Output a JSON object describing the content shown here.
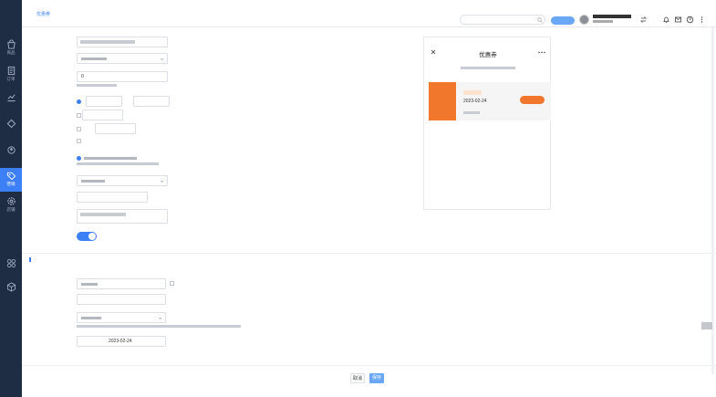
{
  "sidebar": {
    "logo": "",
    "items": [
      {
        "label": "商品",
        "icon": "bag-icon"
      },
      {
        "label": "订单",
        "icon": "document-icon"
      },
      {
        "label": "",
        "icon": "chart-icon"
      },
      {
        "label": "",
        "icon": "share-icon"
      },
      {
        "label": "",
        "icon": "user-icon"
      },
      {
        "label": "营销",
        "icon": "tag-icon"
      },
      {
        "label": "店铺",
        "icon": "gear-icon"
      },
      {
        "label": "",
        "icon": "app-center-icon"
      },
      {
        "label": "",
        "icon": "cube-icon"
      }
    ]
  },
  "header": {
    "crumbs": [
      "",
      "",
      "优惠券"
    ],
    "search_placeholder": ""
  },
  "form": {
    "quantity_value": "0",
    "time_from_value": "",
    "time_to_value": "",
    "per_user_value": "",
    "per_user_unit": "",
    "per_user_limit_value": "",
    "per_user_limit_unit": "",
    "time_unit": "",
    "date_range_value": "2023-02-24",
    "toggle_state": "on"
  },
  "preview": {
    "status_time": "",
    "battery": "",
    "title": "优惠券",
    "coupon_date": "2023-02-24",
    "coupon_left_text": ""
  },
  "footer": {
    "cancel_label": "取消",
    "save_label": "保存"
  },
  "colors": {
    "accent": "#3d7ff5",
    "sidebar": "#1f2d44",
    "coupon": "#f0772c"
  }
}
